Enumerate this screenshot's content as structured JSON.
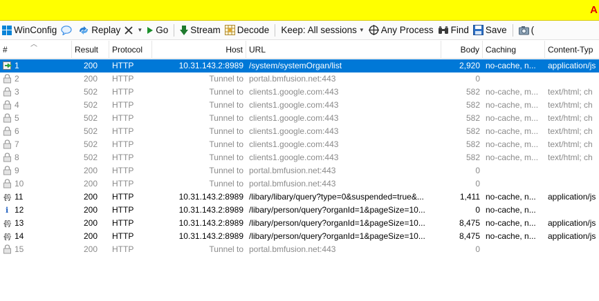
{
  "banner": {
    "warning_glyph": "A"
  },
  "toolbar": {
    "winconfig": "WinConfig",
    "replay": "Replay",
    "go": "Go",
    "stream": "Stream",
    "decode": "Decode",
    "keep": "Keep: All sessions",
    "process": "Any Process",
    "find": "Find",
    "save": "Save",
    "trailing": "("
  },
  "columns": {
    "num": "#",
    "result": "Result",
    "protocol": "Protocol",
    "host": "Host",
    "url": "URL",
    "body": "Body",
    "caching": "Caching",
    "content_type": "Content-Typ"
  },
  "sessions": [
    {
      "num": "1",
      "icon": "arrow-icon",
      "result": "200",
      "protocol": "HTTP",
      "host": "10.31.143.2:8989",
      "url": "/system/systemOrgan/list",
      "body": "2,920",
      "caching": "no-cache, n...",
      "ctype": "application/js",
      "style": "sel"
    },
    {
      "num": "2",
      "icon": "lock-icon",
      "result": "200",
      "protocol": "HTTP",
      "host": "Tunnel to",
      "url": "portal.bmfusion.net:443",
      "body": "0",
      "caching": "",
      "ctype": "",
      "style": "tunnel"
    },
    {
      "num": "3",
      "icon": "lock-icon",
      "result": "502",
      "protocol": "HTTP",
      "host": "Tunnel to",
      "url": "clients1.google.com:443",
      "body": "582",
      "caching": "no-cache, m...",
      "ctype": "text/html; ch",
      "style": "tunnel"
    },
    {
      "num": "4",
      "icon": "lock-icon",
      "result": "502",
      "protocol": "HTTP",
      "host": "Tunnel to",
      "url": "clients1.google.com:443",
      "body": "582",
      "caching": "no-cache, m...",
      "ctype": "text/html; ch",
      "style": "tunnel"
    },
    {
      "num": "5",
      "icon": "lock-icon",
      "result": "502",
      "protocol": "HTTP",
      "host": "Tunnel to",
      "url": "clients1.google.com:443",
      "body": "582",
      "caching": "no-cache, m...",
      "ctype": "text/html; ch",
      "style": "tunnel"
    },
    {
      "num": "6",
      "icon": "lock-icon",
      "result": "502",
      "protocol": "HTTP",
      "host": "Tunnel to",
      "url": "clients1.google.com:443",
      "body": "582",
      "caching": "no-cache, m...",
      "ctype": "text/html; ch",
      "style": "tunnel"
    },
    {
      "num": "7",
      "icon": "lock-icon",
      "result": "502",
      "protocol": "HTTP",
      "host": "Tunnel to",
      "url": "clients1.google.com:443",
      "body": "582",
      "caching": "no-cache, m...",
      "ctype": "text/html; ch",
      "style": "tunnel"
    },
    {
      "num": "8",
      "icon": "lock-icon",
      "result": "502",
      "protocol": "HTTP",
      "host": "Tunnel to",
      "url": "clients1.google.com:443",
      "body": "582",
      "caching": "no-cache, m...",
      "ctype": "text/html; ch",
      "style": "tunnel"
    },
    {
      "num": "9",
      "icon": "lock-icon",
      "result": "200",
      "protocol": "HTTP",
      "host": "Tunnel to",
      "url": "portal.bmfusion.net:443",
      "body": "0",
      "caching": "",
      "ctype": "",
      "style": "tunnel"
    },
    {
      "num": "10",
      "icon": "lock-icon",
      "result": "200",
      "protocol": "HTTP",
      "host": "Tunnel to",
      "url": "portal.bmfusion.net:443",
      "body": "0",
      "caching": "",
      "ctype": "",
      "style": "tunnel"
    },
    {
      "num": "11",
      "icon": "json-icon",
      "result": "200",
      "protocol": "HTTP",
      "host": "10.31.143.2:8989",
      "url": "/libary/libary/query?type=0&suspended=true&...",
      "body": "1,411",
      "caching": "no-cache, n...",
      "ctype": "application/js",
      "style": "normal"
    },
    {
      "num": "12",
      "icon": "info-icon",
      "result": "200",
      "protocol": "HTTP",
      "host": "10.31.143.2:8989",
      "url": "/libary/person/query?organId=1&pageSize=10...",
      "body": "0",
      "caching": "no-cache, n...",
      "ctype": "",
      "style": "normal"
    },
    {
      "num": "13",
      "icon": "json-icon",
      "result": "200",
      "protocol": "HTTP",
      "host": "10.31.143.2:8989",
      "url": "/libary/person/query?organId=1&pageSize=10...",
      "body": "8,475",
      "caching": "no-cache, n...",
      "ctype": "application/js",
      "style": "normal"
    },
    {
      "num": "14",
      "icon": "json-icon",
      "result": "200",
      "protocol": "HTTP",
      "host": "10.31.143.2:8989",
      "url": "/libary/person/query?organId=1&pageSize=10...",
      "body": "8,475",
      "caching": "no-cache, n...",
      "ctype": "application/js",
      "style": "normal"
    },
    {
      "num": "15",
      "icon": "lock-icon",
      "result": "200",
      "protocol": "HTTP",
      "host": "Tunnel to",
      "url": "portal.bmfusion.net:443",
      "body": "0",
      "caching": "",
      "ctype": "",
      "style": "tunnel"
    }
  ],
  "colors": {
    "banner": "#ffff00",
    "selection": "#0078d7",
    "tunnel_text": "#8a8a8a",
    "warning": "#e00000"
  }
}
